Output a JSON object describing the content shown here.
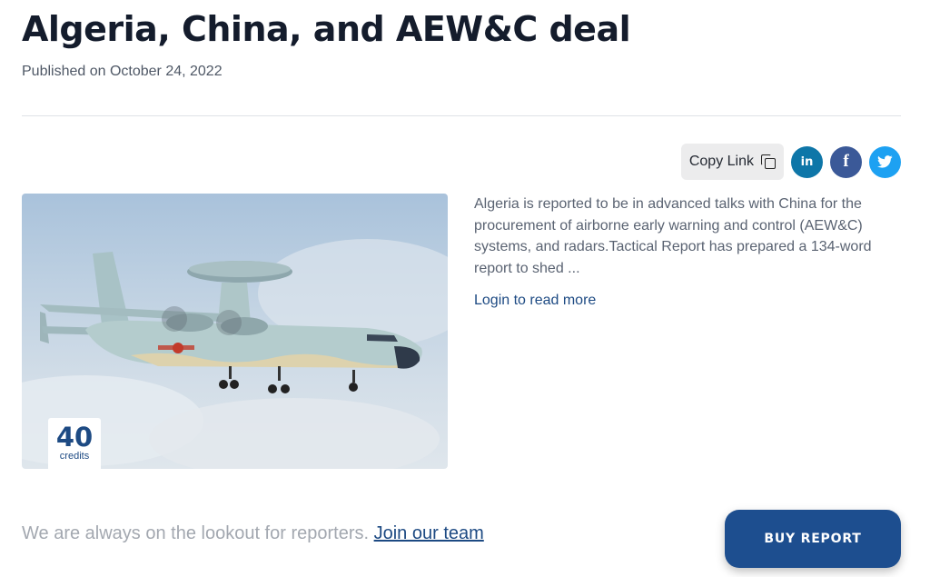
{
  "article": {
    "title": "Algeria, China, and AEW&C deal",
    "published": "Published on October 24, 2022",
    "excerpt": "Algeria is reported to be in advanced talks with China for the procurement of airborne early warning and control (AEW&C) systems, and radars.Tactical Report has prepared a 134-word report to shed ...",
    "login_link": "Login to read more"
  },
  "share": {
    "copy_link_label": "Copy Link",
    "icons": [
      "copy-icon",
      "linkedin-icon",
      "facebook-icon",
      "twitter-icon"
    ],
    "linkedin_glyph": "in",
    "facebook_glyph": "f",
    "twitter_glyph": "🐦",
    "colors": {
      "linkedin": "#0e76a8",
      "facebook": "#3b5998",
      "twitter": "#1da1f2"
    }
  },
  "hero": {
    "credits_value": "40",
    "credits_label": "credits"
  },
  "footer": {
    "lookout_text": "We are always on the lookout for reporters. ",
    "join_link": "Join our team",
    "buy_button": "BUY REPORT"
  },
  "colors": {
    "accent": "#1d4e8f",
    "link": "#1d4a83"
  }
}
